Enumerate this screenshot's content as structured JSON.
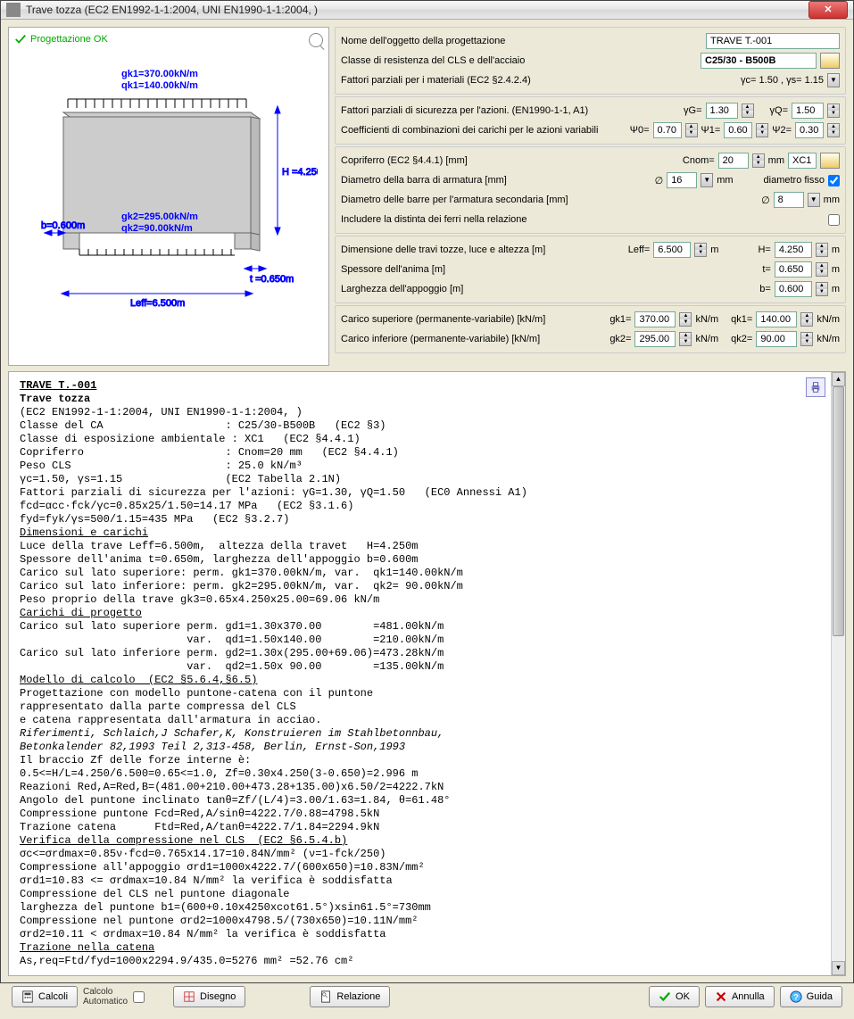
{
  "window": {
    "title": "Trave tozza (EC2 EN1992-1-1:2004, UNI EN1990-1-1:2004, )"
  },
  "diagram": {
    "status": "Progettazione OK",
    "gk1_label": "gk1=370.00kN/m",
    "qk1_label": "qk1=140.00kN/m",
    "gk2_label": "gk2=295.00kN/m",
    "qk2_label": "qk2=90.00kN/m",
    "H": "H =4.250m",
    "t": "t =0.650m",
    "b": "b=0.600m",
    "Leff": "Leff=6.500m"
  },
  "form": {
    "name_label": "Nome dell'oggetto della progettazione",
    "name_value": "TRAVE T.-001",
    "class_label": "Classe di resistenza del CLS e dell'acciaio",
    "class_value": "C25/30 - B500B",
    "partial_mat_label": "Fattori parziali per i materiali (EC2 §2.4.2.4)",
    "partial_mat_value": "γc= 1.50 , γs= 1.15",
    "safety_label": "Fattori parziali di sicurezza per l'azioni. (EN1990-1-1, A1)",
    "yG_label": "γG=",
    "yG": "1.30",
    "yQ_label": "γQ=",
    "yQ": "1.50",
    "comb_label": "Coefficienti di combinazioni dei carichi per le azioni variabili",
    "psi0_label": "Ψ0=",
    "psi0": "0.70",
    "psi1_label": "Ψ1=",
    "psi1": "0.60",
    "psi2_label": "Ψ2=",
    "psi2": "0.30",
    "cover_label": "Copriferro (EC2 §4.4.1) [mm]",
    "cnom_label": "Cnom=",
    "cnom": "20",
    "exposure": "XC1",
    "dia_label": "Diametro della barra di armatura [mm]",
    "dia": "16",
    "dia_fixed_label": "diametro fisso",
    "dia2_label": "Diametro delle barre per l'armatura secondaria [mm]",
    "dia2": "8",
    "include_label": "Includere la distinta dei ferri nella relazione",
    "dim_label": "Dimensione delle travi tozze, luce e altezza [m]",
    "leff_label": "Leff=",
    "leff": "6.500",
    "H_label": "H=",
    "H": "4.250",
    "thick_label": "Spessore dell'anima [m]",
    "t_label": "t=",
    "t": "0.650",
    "support_label": "Larghezza dell'appoggio [m]",
    "b_label": "b=",
    "b": "0.600",
    "top_load_label": "Carico superiore (permanente-variabile) [kN/m]",
    "gk1_label": "gk1=",
    "gk1": "370.00",
    "qk1_label": "qk1=",
    "qk1": "140.00",
    "bot_load_label": "Carico inferiore (permanente-variabile) [kN/m]",
    "gk2_label": "gk2=",
    "gk2": "295.00",
    "qk2_label": "qk2=",
    "qk2": "90.00",
    "mm": "mm",
    "m": "m",
    "knm": "kN/m"
  },
  "buttons": {
    "calcoli": "Calcoli",
    "auto1": "Calcolo",
    "auto2": "Automatico",
    "disegno": "Disegno",
    "relazione": "Relazione",
    "ok": "OK",
    "annulla": "Annulla",
    "guida": "Guida"
  },
  "report": {
    "lines": [
      {
        "t": "TRAVE T.-001",
        "u": true,
        "b": true
      },
      {
        "t": "Trave tozza",
        "b": true
      },
      {
        "t": "(EC2 EN1992-1-1:2004, UNI EN1990-1-1:2004, )"
      },
      {
        "t": "Classe del CA                   : C25/30-B500B   (EC2 §3)"
      },
      {
        "t": "Classe di esposizione ambientale : XC1   (EC2 §4.4.1)"
      },
      {
        "t": "Copriferro                      : Cnom=20 mm   (EC2 §4.4.1)"
      },
      {
        "t": "Peso CLS                        : 25.0 kN/m³"
      },
      {
        "t": "γc=1.50, γs=1.15                (EC2 Tabella 2.1N)"
      },
      {
        "t": "Fattori parziali di sicurezza per l'azioni: γG=1.30, γQ=1.50   (EC0 Annessi A1)"
      },
      {
        "t": "fcd=αcc·fck/γc=0.85x25/1.50=14.17 MPa   (EC2 §3.1.6)"
      },
      {
        "t": "fyd=fyk/γs=500/1.15=435 MPa   (EC2 §3.2.7)"
      },
      {
        "t": "Dimensioni e carichi",
        "u": true
      },
      {
        "t": "Luce della trave Leff=6.500m,  altezza della travet   H=4.250m"
      },
      {
        "t": "Spessore dell'anima t=0.650m, larghezza dell'appoggio b=0.600m"
      },
      {
        "t": "Carico sul lato superiore: perm. gk1=370.00kN/m, var.  qk1=140.00kN/m"
      },
      {
        "t": "Carico sul lato inferiore: perm. gk2=295.00kN/m, var.  qk2= 90.00kN/m"
      },
      {
        "t": "Peso proprio della trave gk3=0.65x4.250x25.00=69.06 kN/m"
      },
      {
        "t": "Carichi di progetto",
        "u": true
      },
      {
        "t": "Carico sul lato superiore perm. gd1=1.30x370.00        =481.00kN/m"
      },
      {
        "t": "                          var.  qd1=1.50x140.00        =210.00kN/m"
      },
      {
        "t": "Carico sul lato inferiore perm. gd2=1.30x(295.00+69.06)=473.28kN/m"
      },
      {
        "t": "                          var.  qd2=1.50x 90.00        =135.00kN/m"
      },
      {
        "t": "Modello di calcolo  (EC2 §5.6.4,§6.5)",
        "u": true
      },
      {
        "t": "Progettazione con modello puntone-catena con il puntone"
      },
      {
        "t": "rappresentato dalla parte compressa del CLS"
      },
      {
        "t": "e catena rappresentata dall'armatura in acciao."
      },
      {
        "t": "Riferimenti, Schlaich,J Schafer,K, Konstruieren im Stahlbetonnbau,",
        "i": true
      },
      {
        "t": "Betonkalender 82,1993 Teil 2,313-458, Berlin, Ernst-Son,1993",
        "i": true
      },
      {
        "t": "Il braccio Zf delle forze interne è:"
      },
      {
        "t": "0.5<=H/L=4.250/6.500=0.65<=1.0, Zf=0.30x4.250(3-0.650)=2.996 m"
      },
      {
        "t": "Reazioni Red,A=Red,B=(481.00+210.00+473.28+135.00)x6.50/2=4222.7kN"
      },
      {
        "t": "Angolo del puntone inclinato tanθ=Zf/(L/4)=3.00/1.63=1.84, θ=61.48°"
      },
      {
        "t": "Compressione puntone Fcd=Red,A/sinθ=4222.7/0.88=4798.5kN"
      },
      {
        "t": "Trazione catena      Ftd=Red,A/tanθ=4222.7/1.84=2294.9kN"
      },
      {
        "t": "Verifica della compressione nel CLS  (EC2 §6.5.4.b)",
        "u": true
      },
      {
        "t": "σc<=σrdmax=0.85ν·fcd=0.765x14.17=10.84N/mm² (ν=1-fck/250)"
      },
      {
        "t": "Compressione all'appoggio σrd1=1000x4222.7/(600x650)=10.83N/mm²"
      },
      {
        "t": "σrd1=10.83 <= σrdmax=10.84 N/mm² la verifica è soddisfatta"
      },
      {
        "t": "Compressione del CLS nel puntone diagonale"
      },
      {
        "t": "larghezza del puntone b1=(600+0.10x4250xcot61.5°)xsin61.5°=730mm"
      },
      {
        "t": "Compressione nel puntone σrd2=1000x4798.5/(730x650)=10.11N/mm²"
      },
      {
        "t": "σrd2=10.11 < σrdmax=10.84 N/mm² la verifica è soddisfatta"
      },
      {
        "t": "Trazione nella catena",
        "u": true
      },
      {
        "t": "As,req=Ftd/fyd=1000x2294.9/435.0=5276 mm² =52.76 cm²"
      }
    ]
  }
}
